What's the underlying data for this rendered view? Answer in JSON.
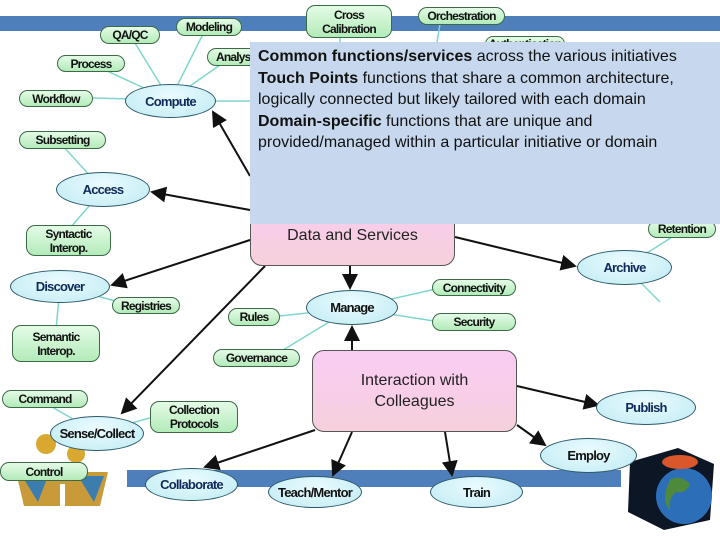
{
  "overlay": {
    "line1_bold": "Common functions/services",
    "line1_rest": " across the various initiatives",
    "line2_bold": "Touch Points",
    "line2_rest": " functions that share a common architecture, logically connected but likely tailored with each domain",
    "line3_bold": "Domain-specific",
    "line3_rest": " functions that are unique and provided/managed within a particular initiative or domain"
  },
  "hubs": {
    "data_services": "Data and Services",
    "interaction": "Interaction with Colleagues"
  },
  "ellipses": {
    "compute": "Compute",
    "access": "Access",
    "discover": "Discover",
    "manage": "Manage",
    "archive": "Archive",
    "sense_collect": "Sense/Collect",
    "collaborate": "Collaborate",
    "teach_mentor": "Teach/Mentor",
    "train": "Train",
    "publish": "Publish",
    "employ": "Employ"
  },
  "tags": {
    "qaqc": "QA/QC",
    "modeling": "Modeling",
    "cross_calibration": "Cross Calibration",
    "orchestration": "Orchestration",
    "authentication": "Authentication",
    "analysis": "Analysis",
    "process": "Process",
    "workflow": "Workflow",
    "subsetting": "Subsetting",
    "syntactic": "Syntactic Interop.",
    "retention": "Retention",
    "registries": "Registries",
    "semantic": "Semantic Interop.",
    "rules": "Rules",
    "connectivity": "Connectivity",
    "security": "Security",
    "governance": "Governance",
    "command": "Command",
    "collection_protocols": "Collection Protocols",
    "control": "Control"
  },
  "colors": {
    "band": "#4f7fba",
    "overlay": "#c7d8ee",
    "tag": "#c5f2c9",
    "ellipse": "#c9eef5",
    "hub": "#f8ccec"
  }
}
